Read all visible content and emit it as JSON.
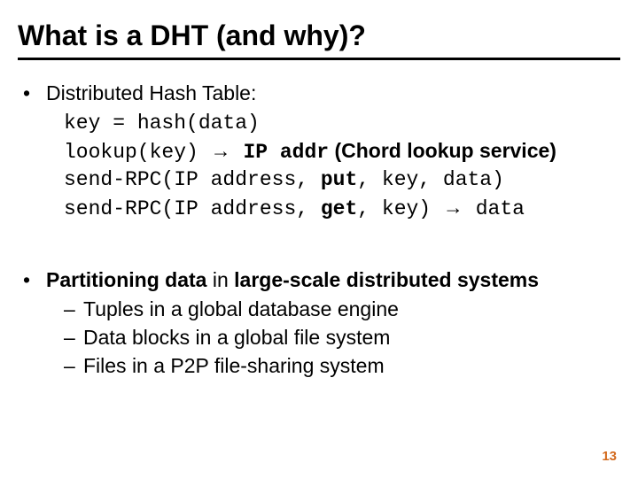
{
  "title": "What is a DHT (and why)?",
  "bullet1_label": "Distributed Hash Table:",
  "code": {
    "l1": "key = hash(data)",
    "l2a": "lookup(key) ",
    "l2arrow": "→",
    "l2b": " IP addr",
    "l2c": " (Chord lookup service)",
    "l3a": "send-RPC(IP address, ",
    "l3b": "put",
    "l3c": ", key, data)",
    "l4a": "send-RPC(IP address, ",
    "l4b": "get",
    "l4c": ", key) ",
    "l4arrow": "→",
    "l4d": " data"
  },
  "bullet2_a": "Partitioning data",
  "bullet2_b": " in ",
  "bullet2_c": "large-scale distributed systems",
  "sub1": "Tuples in a global database engine",
  "sub2": "Data blocks in a global file system",
  "sub3": "Files in a P2P file-sharing system",
  "pagenum": "13"
}
